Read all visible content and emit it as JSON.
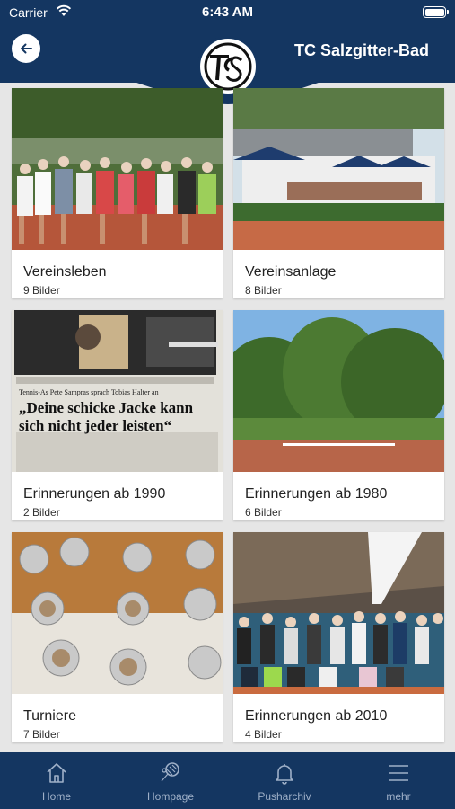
{
  "status_bar": {
    "carrier": "Carrier",
    "time": "6:43 AM"
  },
  "header": {
    "title": "TC Salzgitter-Bad",
    "logo_text": "TCS"
  },
  "albums": [
    {
      "name": "Vereinsleben",
      "count": "9 Bilder",
      "photo": "group-photo"
    },
    {
      "name": "Vereinsanlage",
      "count": "8 Bilder",
      "photo": "clubhouse-photo"
    },
    {
      "name": "Erinnerungen ab 1990",
      "count": "2 Bilder",
      "photo": "newspaper-photo",
      "photo_text": {
        "caption": "Tennis-As Pete Sampras sprach Tobias Halter an",
        "headline_1": "„Deine schicke Jacke kann",
        "headline_2": "sich nicht jeder leisten“"
      }
    },
    {
      "name": "Erinnerungen ab 1980",
      "count": "6 Bilder",
      "photo": "trees-photo"
    },
    {
      "name": "Turniere",
      "count": "7 Bilder",
      "photo": "trophies-photo"
    },
    {
      "name": "Erinnerungen ab 2010",
      "count": "4 Bilder",
      "photo": "indoor-hall-photo"
    }
  ],
  "tabs": [
    {
      "label": "Home",
      "icon": "home-icon"
    },
    {
      "label": "Hompage",
      "icon": "tennis-racket-icon"
    },
    {
      "label": "Pusharchiv",
      "icon": "bell-icon"
    },
    {
      "label": "mehr",
      "icon": "menu-icon"
    }
  ],
  "colors": {
    "primary": "#143661",
    "background": "#e6e6e6",
    "tab_inactive": "#9fb0c8"
  }
}
